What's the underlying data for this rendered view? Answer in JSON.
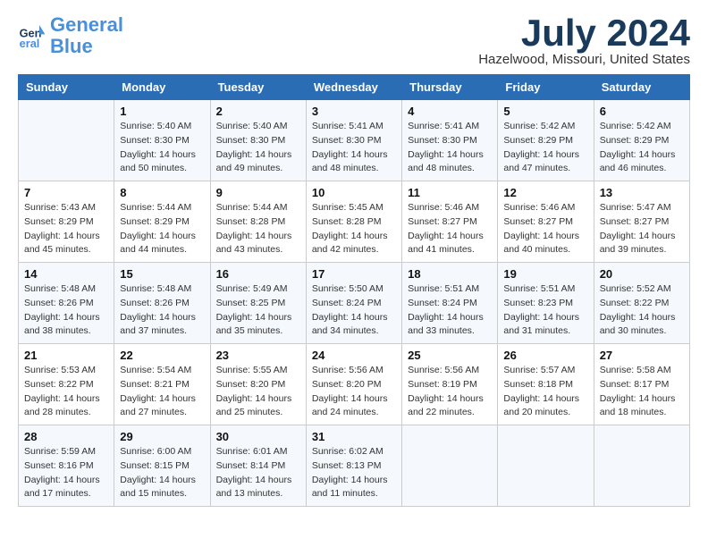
{
  "logo": {
    "line1": "General",
    "line2": "Blue"
  },
  "title": "July 2024",
  "location": "Hazelwood, Missouri, United States",
  "days_of_week": [
    "Sunday",
    "Monday",
    "Tuesday",
    "Wednesday",
    "Thursday",
    "Friday",
    "Saturday"
  ],
  "weeks": [
    [
      {
        "day": "",
        "info": ""
      },
      {
        "day": "1",
        "info": "Sunrise: 5:40 AM\nSunset: 8:30 PM\nDaylight: 14 hours\nand 50 minutes."
      },
      {
        "day": "2",
        "info": "Sunrise: 5:40 AM\nSunset: 8:30 PM\nDaylight: 14 hours\nand 49 minutes."
      },
      {
        "day": "3",
        "info": "Sunrise: 5:41 AM\nSunset: 8:30 PM\nDaylight: 14 hours\nand 48 minutes."
      },
      {
        "day": "4",
        "info": "Sunrise: 5:41 AM\nSunset: 8:30 PM\nDaylight: 14 hours\nand 48 minutes."
      },
      {
        "day": "5",
        "info": "Sunrise: 5:42 AM\nSunset: 8:29 PM\nDaylight: 14 hours\nand 47 minutes."
      },
      {
        "day": "6",
        "info": "Sunrise: 5:42 AM\nSunset: 8:29 PM\nDaylight: 14 hours\nand 46 minutes."
      }
    ],
    [
      {
        "day": "7",
        "info": "Sunrise: 5:43 AM\nSunset: 8:29 PM\nDaylight: 14 hours\nand 45 minutes."
      },
      {
        "day": "8",
        "info": "Sunrise: 5:44 AM\nSunset: 8:29 PM\nDaylight: 14 hours\nand 44 minutes."
      },
      {
        "day": "9",
        "info": "Sunrise: 5:44 AM\nSunset: 8:28 PM\nDaylight: 14 hours\nand 43 minutes."
      },
      {
        "day": "10",
        "info": "Sunrise: 5:45 AM\nSunset: 8:28 PM\nDaylight: 14 hours\nand 42 minutes."
      },
      {
        "day": "11",
        "info": "Sunrise: 5:46 AM\nSunset: 8:27 PM\nDaylight: 14 hours\nand 41 minutes."
      },
      {
        "day": "12",
        "info": "Sunrise: 5:46 AM\nSunset: 8:27 PM\nDaylight: 14 hours\nand 40 minutes."
      },
      {
        "day": "13",
        "info": "Sunrise: 5:47 AM\nSunset: 8:27 PM\nDaylight: 14 hours\nand 39 minutes."
      }
    ],
    [
      {
        "day": "14",
        "info": "Sunrise: 5:48 AM\nSunset: 8:26 PM\nDaylight: 14 hours\nand 38 minutes."
      },
      {
        "day": "15",
        "info": "Sunrise: 5:48 AM\nSunset: 8:26 PM\nDaylight: 14 hours\nand 37 minutes."
      },
      {
        "day": "16",
        "info": "Sunrise: 5:49 AM\nSunset: 8:25 PM\nDaylight: 14 hours\nand 35 minutes."
      },
      {
        "day": "17",
        "info": "Sunrise: 5:50 AM\nSunset: 8:24 PM\nDaylight: 14 hours\nand 34 minutes."
      },
      {
        "day": "18",
        "info": "Sunrise: 5:51 AM\nSunset: 8:24 PM\nDaylight: 14 hours\nand 33 minutes."
      },
      {
        "day": "19",
        "info": "Sunrise: 5:51 AM\nSunset: 8:23 PM\nDaylight: 14 hours\nand 31 minutes."
      },
      {
        "day": "20",
        "info": "Sunrise: 5:52 AM\nSunset: 8:22 PM\nDaylight: 14 hours\nand 30 minutes."
      }
    ],
    [
      {
        "day": "21",
        "info": "Sunrise: 5:53 AM\nSunset: 8:22 PM\nDaylight: 14 hours\nand 28 minutes."
      },
      {
        "day": "22",
        "info": "Sunrise: 5:54 AM\nSunset: 8:21 PM\nDaylight: 14 hours\nand 27 minutes."
      },
      {
        "day": "23",
        "info": "Sunrise: 5:55 AM\nSunset: 8:20 PM\nDaylight: 14 hours\nand 25 minutes."
      },
      {
        "day": "24",
        "info": "Sunrise: 5:56 AM\nSunset: 8:20 PM\nDaylight: 14 hours\nand 24 minutes."
      },
      {
        "day": "25",
        "info": "Sunrise: 5:56 AM\nSunset: 8:19 PM\nDaylight: 14 hours\nand 22 minutes."
      },
      {
        "day": "26",
        "info": "Sunrise: 5:57 AM\nSunset: 8:18 PM\nDaylight: 14 hours\nand 20 minutes."
      },
      {
        "day": "27",
        "info": "Sunrise: 5:58 AM\nSunset: 8:17 PM\nDaylight: 14 hours\nand 18 minutes."
      }
    ],
    [
      {
        "day": "28",
        "info": "Sunrise: 5:59 AM\nSunset: 8:16 PM\nDaylight: 14 hours\nand 17 minutes."
      },
      {
        "day": "29",
        "info": "Sunrise: 6:00 AM\nSunset: 8:15 PM\nDaylight: 14 hours\nand 15 minutes."
      },
      {
        "day": "30",
        "info": "Sunrise: 6:01 AM\nSunset: 8:14 PM\nDaylight: 14 hours\nand 13 minutes."
      },
      {
        "day": "31",
        "info": "Sunrise: 6:02 AM\nSunset: 8:13 PM\nDaylight: 14 hours\nand 11 minutes."
      },
      {
        "day": "",
        "info": ""
      },
      {
        "day": "",
        "info": ""
      },
      {
        "day": "",
        "info": ""
      }
    ]
  ]
}
